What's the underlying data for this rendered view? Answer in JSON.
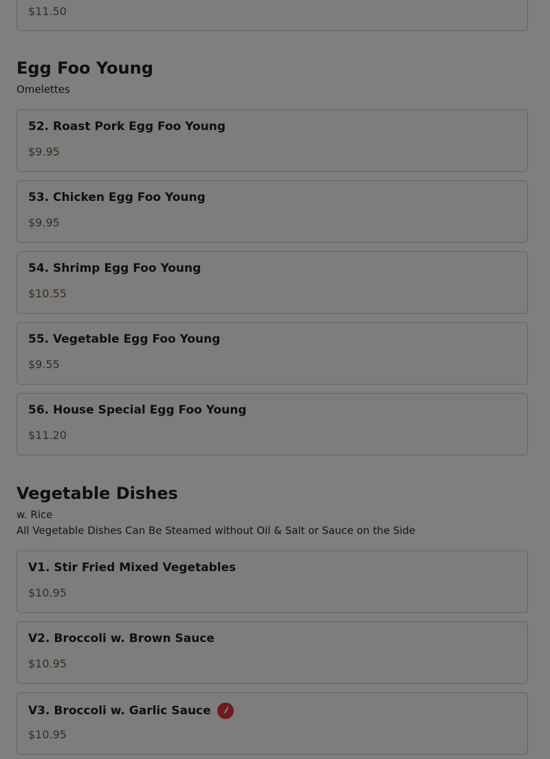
{
  "top_card": {
    "price": "$11.50"
  },
  "sections": [
    {
      "title": "Egg Foo Young",
      "subtitles": [
        "Omelettes"
      ],
      "items": [
        {
          "name": "52. Roast Pork Egg Foo Young",
          "price": "$9.95"
        },
        {
          "name": "53. Chicken Egg Foo Young",
          "price": "$9.95"
        },
        {
          "name": "54. Shrimp Egg Foo Young",
          "price": "$10.55"
        },
        {
          "name": "55. Vegetable Egg Foo Young",
          "price": "$9.55"
        },
        {
          "name": "56. House Special Egg Foo Young",
          "price": "$11.20"
        }
      ]
    },
    {
      "title": "Vegetable Dishes",
      "subtitles": [
        "w. Rice",
        "All Vegetable Dishes Can Be Steamed without Oil & Salt or Sauce on the Side"
      ],
      "items": [
        {
          "name": "V1. Stir Fried Mixed Vegetables",
          "price": "$10.95"
        },
        {
          "name": "V2. Broccoli w. Brown Sauce",
          "price": "$10.95"
        },
        {
          "name": "V3. Broccoli w. Garlic Sauce",
          "price": "$10.95",
          "icon": "spicy-pepper-icon"
        }
      ]
    }
  ],
  "colors": {
    "price": "#6b5840",
    "overlay": "rgba(0,0,0,0.5)",
    "spicy": "#e03535"
  }
}
